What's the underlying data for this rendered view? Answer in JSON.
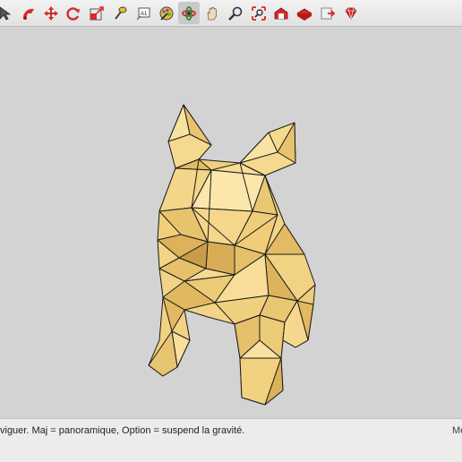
{
  "toolbar": {
    "tools": [
      {
        "name": "select-icon"
      },
      {
        "name": "paint-bucket-icon"
      },
      {
        "name": "move-icon"
      },
      {
        "name": "rotate-icon"
      },
      {
        "name": "scale-icon"
      },
      {
        "name": "tape-measure-icon"
      },
      {
        "name": "text-icon",
        "label": "A1"
      },
      {
        "name": "paint-icon"
      },
      {
        "name": "orbit-icon",
        "active": true
      },
      {
        "name": "pan-icon"
      },
      {
        "name": "zoom-icon"
      },
      {
        "name": "zoom-extents-icon"
      },
      {
        "name": "warehouse-icon"
      },
      {
        "name": "extension-warehouse-icon"
      },
      {
        "name": "layout-icon"
      },
      {
        "name": "ruby-icon"
      }
    ]
  },
  "status": {
    "hint": "viguer. Maj = panoramique, Option =  suspend la gravité.",
    "measurements_label": "Me"
  },
  "colors": {
    "model_fill": "#f3d386",
    "model_stroke": "#1b1b1b",
    "background": "#d3d3d3"
  }
}
